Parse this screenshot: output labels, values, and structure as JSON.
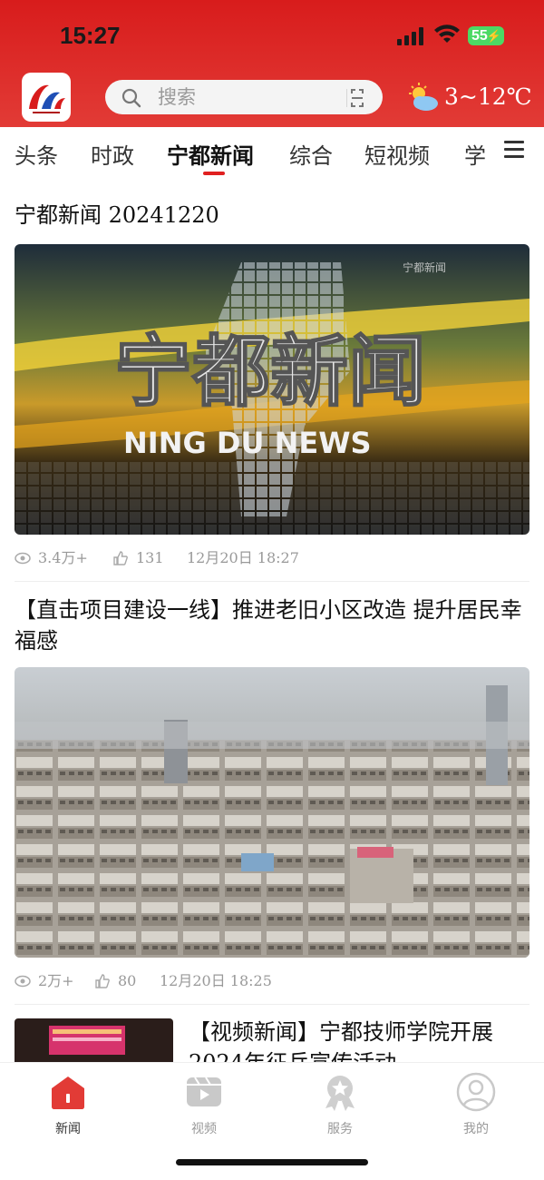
{
  "status": {
    "time": "15:27",
    "battery": "55"
  },
  "header": {
    "search_placeholder": "搜索",
    "weather_temp": "3~12℃"
  },
  "tabs": [
    "头条",
    "时政",
    "宁都新闻",
    "综合",
    "短视频",
    "学"
  ],
  "active_tab": "宁都新闻",
  "articles": [
    {
      "title": "宁都新闻 20241220",
      "cover_title": "宁都新闻",
      "cover_subtitle": "NING DU NEWS",
      "cover_watermark": "宁都新闻",
      "views": "3.4万+",
      "likes": "131",
      "date": "12月20日  18:27"
    },
    {
      "title": "【直击项目建设一线】推进老旧小区改造 提升居民幸福感",
      "views": "2万+",
      "likes": "80",
      "date": "12月20日  18:25"
    },
    {
      "title": "【视频新闻】宁都技师学院开展2024年征兵宣传活动"
    }
  ],
  "bottom_nav": [
    {
      "label": "新闻",
      "icon": "news-icon",
      "active": true
    },
    {
      "label": "视频",
      "icon": "video-icon",
      "active": false
    },
    {
      "label": "服务",
      "icon": "service-icon",
      "active": false
    },
    {
      "label": "我的",
      "icon": "profile-icon",
      "active": false
    }
  ],
  "colors": {
    "brand_red": "#d81c1c",
    "accent_underline": "#e02020"
  }
}
